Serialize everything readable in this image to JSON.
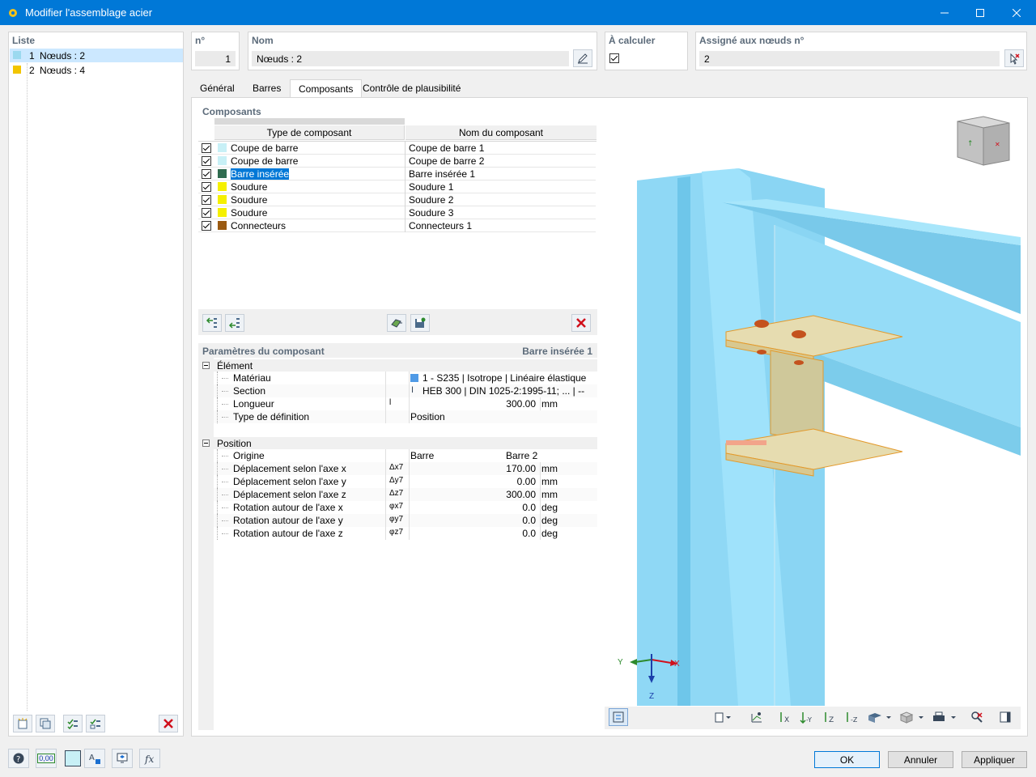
{
  "window": {
    "title": "Modifier l'assemblage acier"
  },
  "list": {
    "label": "Liste",
    "items": [
      {
        "num": "1",
        "text": "Nœuds : 2",
        "color": "#9bd9ef",
        "selected": true
      },
      {
        "num": "2",
        "text": "Nœuds : 4",
        "color": "#f2c500",
        "selected": false
      }
    ]
  },
  "header": {
    "no_label": "n°",
    "no_value": "1",
    "name_label": "Nom",
    "name_value": "Nœuds : 2",
    "calc_label": "À calculer",
    "calc_checked": true,
    "assigned_label": "Assigné aux nœuds n°",
    "assigned_value": "2"
  },
  "tabs": [
    "Général",
    "Barres",
    "Composants",
    "Contrôle de plausibilité"
  ],
  "components": {
    "title": "Composants",
    "col_type": "Type de composant",
    "col_name": "Nom du composant",
    "rows": [
      {
        "type": "Coupe de barre",
        "name": "Coupe de barre 1",
        "color": "#c8f0f6"
      },
      {
        "type": "Coupe de barre",
        "name": "Coupe de barre 2",
        "color": "#c8f0f6"
      },
      {
        "type": "Barre insérée",
        "name": "Barre insérée 1",
        "color": "#2f6b4f"
      },
      {
        "type": "Soudure",
        "name": "Soudure 1",
        "color": "#f5f000"
      },
      {
        "type": "Soudure",
        "name": "Soudure 2",
        "color": "#f5f000"
      },
      {
        "type": "Soudure",
        "name": "Soudure 3",
        "color": "#f5f000"
      },
      {
        "type": "Connecteurs",
        "name": "Connecteurs 1",
        "color": "#9a5a12"
      }
    ]
  },
  "params": {
    "title": "Paramètres du composant",
    "current": "Barre insérée 1",
    "element_group": "Élément",
    "element_rows": [
      {
        "label": "Matériau",
        "sym": "",
        "value": "1 - S235 | Isotrope | Linéaire élastique",
        "unit": ""
      },
      {
        "label": "Section",
        "sym": "",
        "value": "HEB 300 | DIN 1025-2:1995-11; ... | --",
        "unit": ""
      },
      {
        "label": "Longueur",
        "sym": "l",
        "value": "300.00",
        "unit": "mm"
      },
      {
        "label": "Type de définition",
        "sym": "",
        "value": "Position",
        "unit": ""
      }
    ],
    "position_group": "Position",
    "position_rows": [
      {
        "label": "Origine",
        "sym": "",
        "value": "Barre",
        "value2": "Barre 2",
        "unit": ""
      },
      {
        "label": "Déplacement selon l'axe x",
        "sub": "7",
        "sym": "Δx7",
        "value": "170.00",
        "unit": "mm"
      },
      {
        "label": "Déplacement selon l'axe y",
        "sub": "7",
        "sym": "Δy7",
        "value": "0.00",
        "unit": "mm"
      },
      {
        "label": "Déplacement selon l'axe z",
        "sub": "7",
        "sym": "Δz7",
        "value": "300.00",
        "unit": "mm"
      },
      {
        "label": "Rotation autour de l'axe x",
        "sub": "7",
        "sym": "φx7",
        "value": "0.0",
        "unit": "deg"
      },
      {
        "label": "Rotation autour de l'axe y",
        "sub": "7",
        "sym": "φy7",
        "value": "0.0",
        "unit": "deg"
      },
      {
        "label": "Rotation autour de l'axe z",
        "sub": "7",
        "sym": "φz7",
        "value": "0.0",
        "unit": "deg"
      }
    ]
  },
  "view3d": {
    "axis_x": "X",
    "axis_y": "Y",
    "axis_z": "Z"
  },
  "footer": {
    "ok": "OK",
    "cancel": "Annuler",
    "apply": "Appliquer",
    "units_icon": "0,00"
  },
  "colors": {
    "accent": "#0078d7",
    "beam": "#7fd3f5",
    "steel": "#e3d6a2"
  }
}
